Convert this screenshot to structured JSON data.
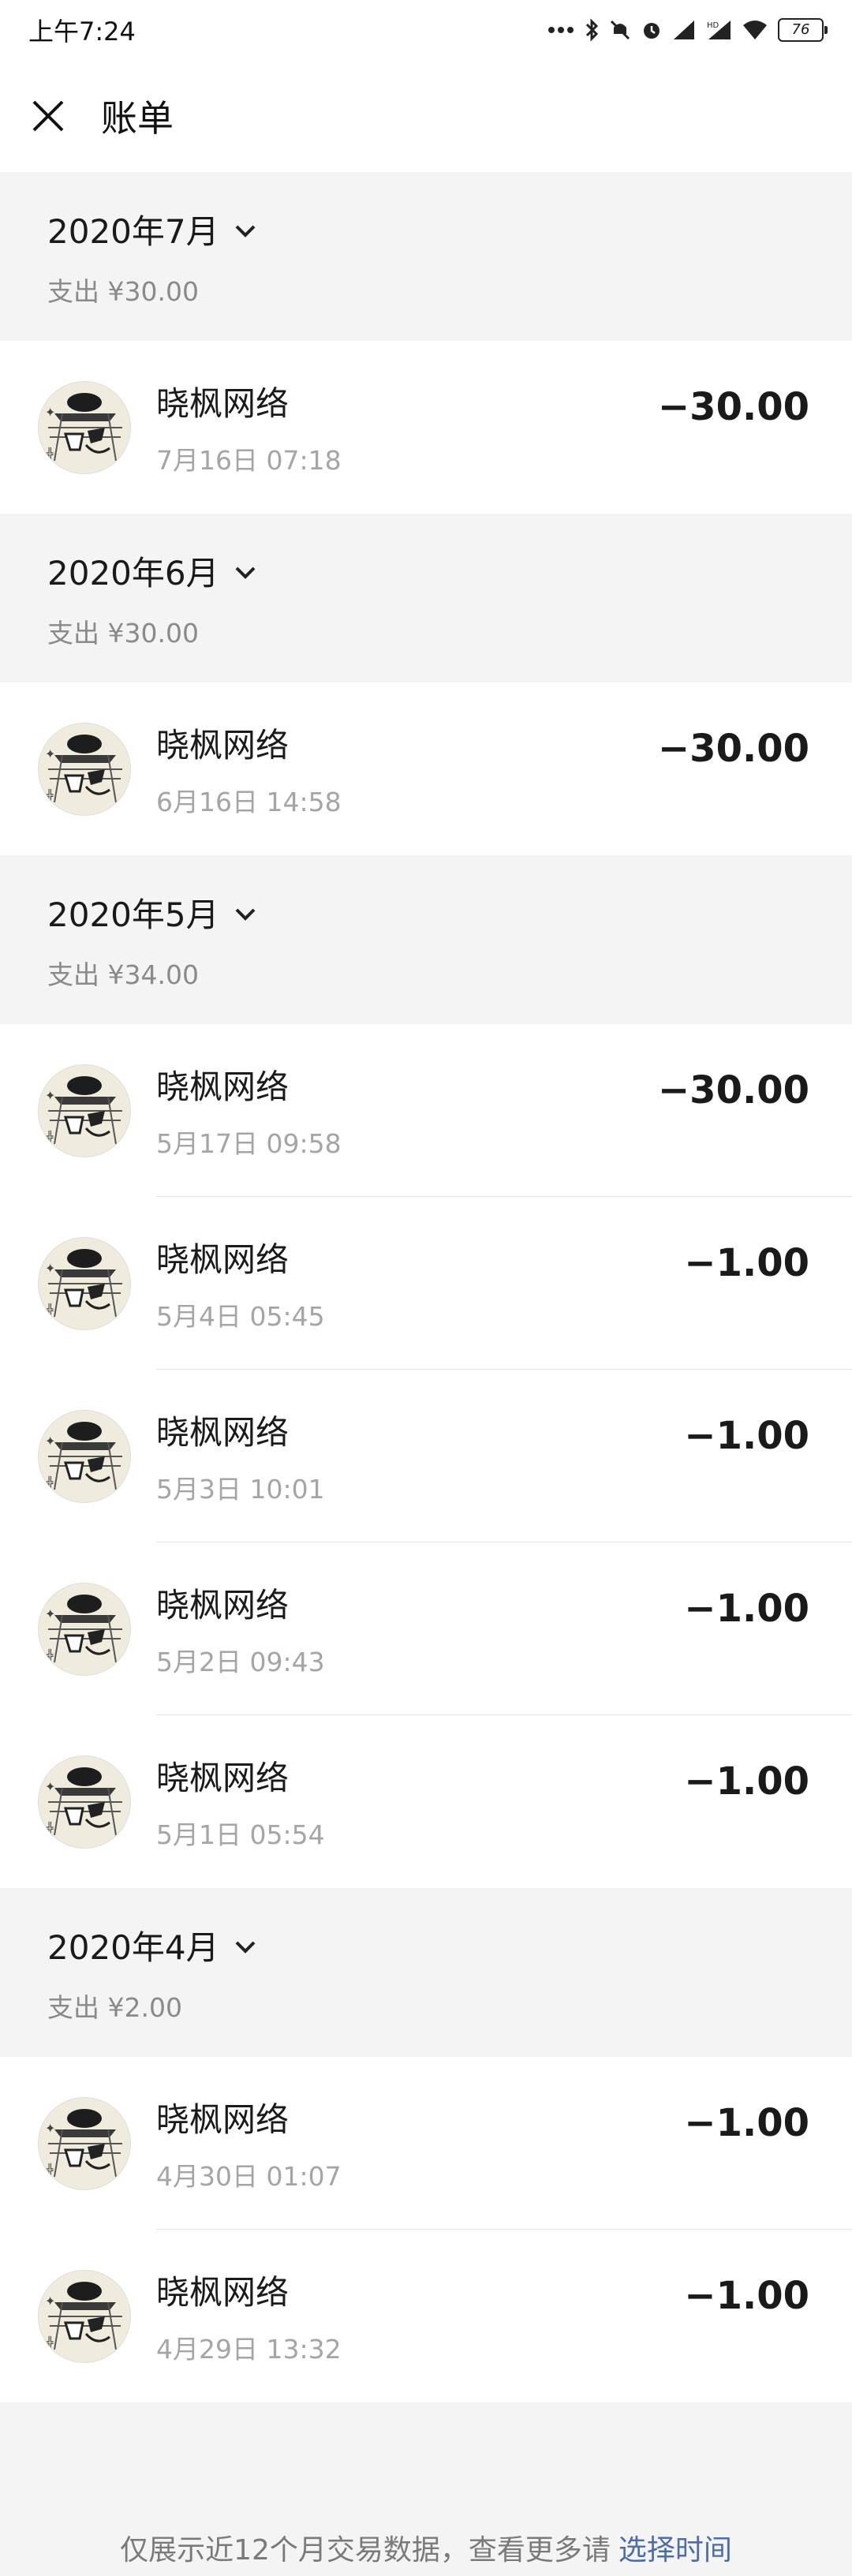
{
  "status": {
    "time": "上午7:24",
    "battery": "76"
  },
  "nav": {
    "title": "账单"
  },
  "months": [
    {
      "label": "2020年7月",
      "summary": "支出 ¥30.00",
      "items": [
        {
          "name": "晓枫网络",
          "time": "7月16日 07:18",
          "amount": "−30.00"
        }
      ]
    },
    {
      "label": "2020年6月",
      "summary": "支出 ¥30.00",
      "items": [
        {
          "name": "晓枫网络",
          "time": "6月16日 14:58",
          "amount": "−30.00"
        }
      ]
    },
    {
      "label": "2020年5月",
      "summary": "支出 ¥34.00",
      "items": [
        {
          "name": "晓枫网络",
          "time": "5月17日 09:58",
          "amount": "−30.00"
        },
        {
          "name": "晓枫网络",
          "time": "5月4日 05:45",
          "amount": "−1.00"
        },
        {
          "name": "晓枫网络",
          "time": "5月3日 10:01",
          "amount": "−1.00"
        },
        {
          "name": "晓枫网络",
          "time": "5月2日 09:43",
          "amount": "−1.00"
        },
        {
          "name": "晓枫网络",
          "time": "5月1日 05:54",
          "amount": "−1.00"
        }
      ]
    },
    {
      "label": "2020年4月",
      "summary": "支出 ¥2.00",
      "items": [
        {
          "name": "晓枫网络",
          "time": "4月30日 01:07",
          "amount": "−1.00"
        },
        {
          "name": "晓枫网络",
          "time": "4月29日 13:32",
          "amount": "−1.00"
        }
      ]
    }
  ],
  "footer": {
    "text": "仅展示近12个月交易数据，查看更多请",
    "link": "选择时间"
  },
  "icons": {
    "close": "close-icon",
    "chevron": "chevron-down-icon",
    "avatar": "merchant-avatar"
  }
}
